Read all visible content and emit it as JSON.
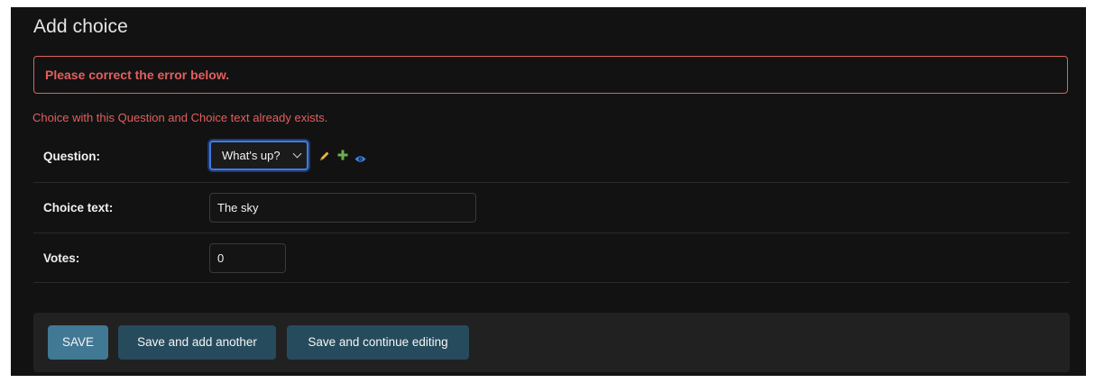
{
  "page": {
    "title": "Add choice"
  },
  "errors": {
    "note": "Please correct the error below.",
    "nonfield": "Choice with this Question and Choice text already exists."
  },
  "form": {
    "question": {
      "label": "Question:",
      "selected": "What's up?"
    },
    "choice_text": {
      "label": "Choice text:",
      "value": "The sky"
    },
    "votes": {
      "label": "Votes:",
      "value": "0"
    }
  },
  "buttons": {
    "save": "Save",
    "save_add_another": "Save and add another",
    "save_continue": "Save and continue editing"
  },
  "icons": {
    "change": "pencil-icon",
    "add": "plus-icon",
    "view": "eye-icon"
  },
  "colors": {
    "error": "#e35f5f",
    "primary_button": "#417893",
    "secondary_button": "#264b5d",
    "focus": "#3f7be0",
    "change_icon": "#e8b53a",
    "add_icon": "#6ab04c",
    "view_icon": "#3d7fe0"
  }
}
